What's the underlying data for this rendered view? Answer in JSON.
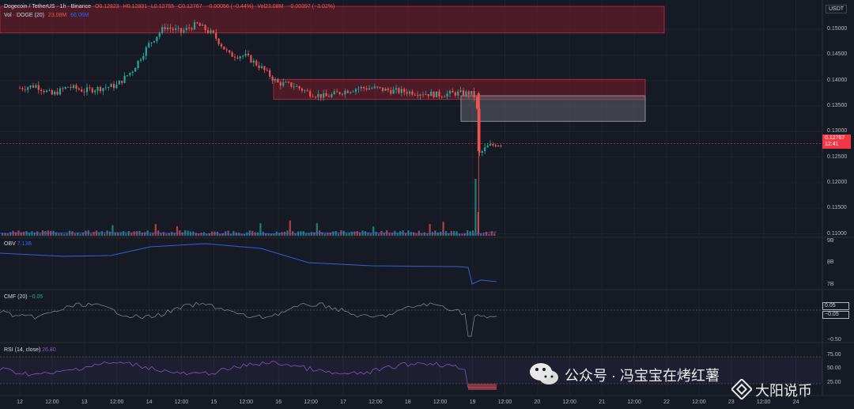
{
  "header": {
    "symbol": "Dogecoin / TetherUS · 1h · Binance",
    "ohlc": {
      "o": "O0.12823",
      "h": "H0.12831",
      "l": "L0.12755",
      "c": "C0.12767",
      "change": "−0.00056 (−0.44%)",
      "vol": "Vol23.08M",
      "vol_change": "−0.00397 (−3.02%)"
    },
    "vol_indicator": {
      "label": "Vol · DOGE (20)",
      "v1": "23.08M",
      "v2": "66.06M"
    }
  },
  "currency": "USDT",
  "price_axis": [
    "0.15000",
    "0.14500",
    "0.14000",
    "0.13500",
    "0.13000",
    "0.12500",
    "0.12000",
    "0.11500",
    "0.11000"
  ],
  "last_price": {
    "value": "0.12767",
    "countdown": "12:41"
  },
  "panes": {
    "obv": {
      "label": "OBV",
      "value": "7.13B",
      "ticks": [
        "9B",
        "8B",
        "7B"
      ]
    },
    "cmf": {
      "label": "CMF (20)",
      "value": "−0.05",
      "ticks": [
        "−0.50"
      ],
      "badge_up": "0.05",
      "badge_down": "−0.05"
    },
    "rsi": {
      "label": "RSI (14, close)",
      "value": "26.80",
      "ticks": [
        "75.00",
        "50.00",
        "25.00"
      ]
    }
  },
  "time_axis": [
    "12",
    "12:00",
    "13",
    "12:00",
    "14",
    "12:00",
    "15",
    "12:00",
    "16",
    "12:00",
    "17",
    "12:00",
    "18",
    "12:00",
    "19",
    "12:00",
    "20",
    "12:00",
    "21",
    "12:00",
    "22",
    "12:00",
    "23",
    "12:00",
    "24"
  ],
  "colors": {
    "up": "#26a69a",
    "down": "#ef5350",
    "background": "#161a25",
    "line": "#3a5ad9",
    "zone": "#7a1e2a",
    "gray_zone": "#6e7079"
  },
  "watermark": {
    "wechat": "公众号 · 冯宝宝在烤红薯",
    "binance": "大阳说币",
    "wechat_icon": "wechat-icon",
    "binance_icon": "binance-icon"
  },
  "chart_data": {
    "type": "candlestick",
    "title": "Dogecoin / TetherUS · 1h · Binance",
    "ylim": [
      0.109,
      0.1545
    ],
    "x": [
      "12",
      "12:00",
      "13",
      "12:00",
      "14",
      "12:00",
      "15",
      "12:00",
      "16",
      "12:00",
      "17",
      "12:00",
      "18",
      "12:00",
      "19",
      "12:00",
      "20",
      "12:00",
      "21",
      "12:00",
      "22",
      "12:00",
      "23",
      "12:00",
      "24"
    ],
    "close_path": [
      [
        "12",
        0.1385
      ],
      [
        "12 06:00",
        0.139
      ],
      [
        "12 12:00",
        0.1372
      ],
      [
        "12 18:00",
        0.1388
      ],
      [
        "13",
        0.138
      ],
      [
        "13 06:00",
        0.1385
      ],
      [
        "13 12:00",
        0.139
      ],
      [
        "13 18:00",
        0.142
      ],
      [
        "14",
        0.147
      ],
      [
        "14 06:00",
        0.1505
      ],
      [
        "14 12:00",
        0.1495
      ],
      [
        "14 18:00",
        0.151
      ],
      [
        "15",
        0.149
      ],
      [
        "15 06:00",
        0.145
      ],
      [
        "15 12:00",
        0.1448
      ],
      [
        "15 18:00",
        0.1425
      ],
      [
        "16",
        0.1395
      ],
      [
        "16 06:00",
        0.139
      ],
      [
        "16 12:00",
        0.1375
      ],
      [
        "16 18:00",
        0.1368
      ],
      [
        "17",
        0.1378
      ],
      [
        "17 06:00",
        0.1385
      ],
      [
        "17 12:00",
        0.1385
      ],
      [
        "17 18:00",
        0.138
      ],
      [
        "18",
        0.1378
      ],
      [
        "18 06:00",
        0.1375
      ],
      [
        "18 12:00",
        0.1372
      ],
      [
        "18 18:00",
        0.1375
      ],
      [
        "19 00:00",
        0.1375
      ],
      [
        "19 02:00",
        0.1365
      ],
      [
        "19 03:00",
        0.1255
      ],
      [
        "19 06:00",
        0.127
      ],
      [
        "19 09:00",
        0.1275
      ],
      [
        "19 12:00",
        0.12767
      ]
    ],
    "zones": [
      {
        "name": "supply-zone-top",
        "y": [
          0.1493,
          0.1545
        ]
      },
      {
        "name": "supply-zone-mid",
        "y": [
          0.1363,
          0.1402
        ]
      },
      {
        "name": "gray-zone",
        "y": [
          0.132,
          0.137
        ]
      }
    ],
    "volume_spikes": [
      {
        "x": "17 12:00",
        "value": "high"
      },
      {
        "x": "19 02:00",
        "value": "very high"
      }
    ]
  }
}
